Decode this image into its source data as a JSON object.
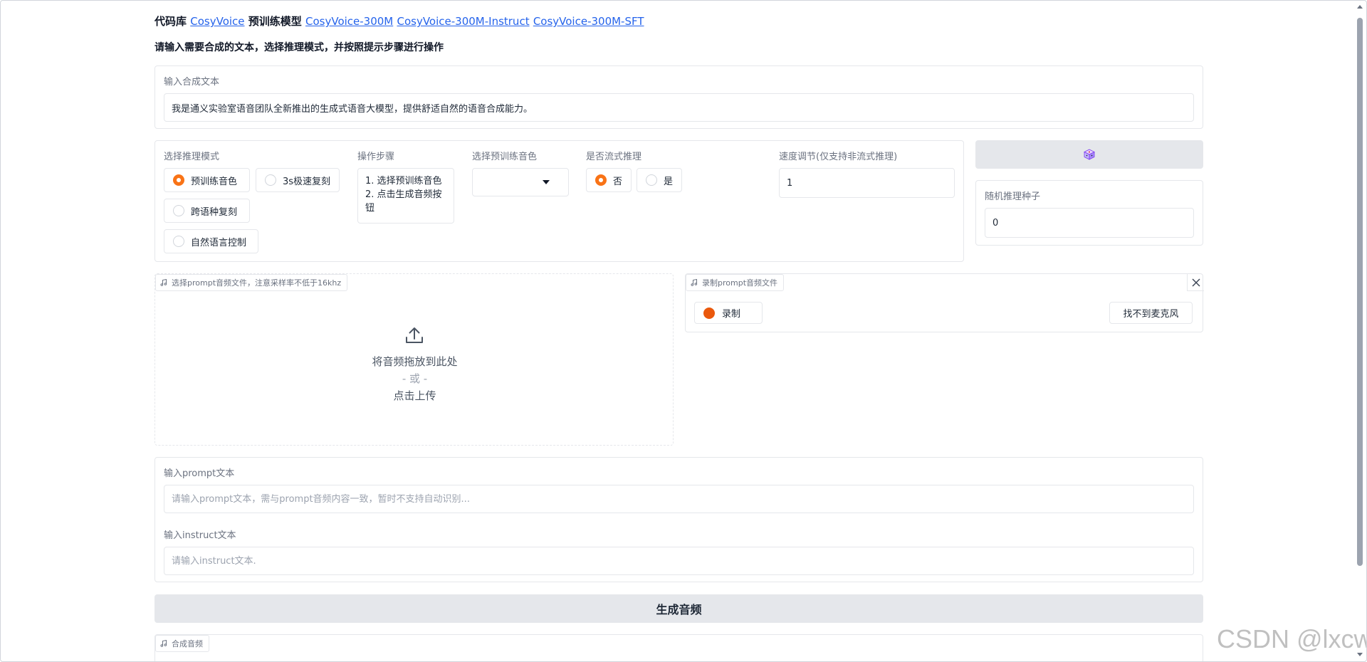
{
  "header": {
    "prefix": "代码库",
    "repo_link": "CosyVoice",
    "models_label": "预训练模型",
    "model_links": [
      "CosyVoice-300M",
      "CosyVoice-300M-Instruct",
      "CosyVoice-300M-SFT"
    ],
    "instruction": "请输入需要合成的文本，选择推理模式，并按照提示步骤进行操作"
  },
  "synth_text": {
    "label": "输入合成文本",
    "value": "我是通义实验室语音团队全新推出的生成式语音大模型，提供舒适自然的语音合成能力。"
  },
  "mode": {
    "label": "选择推理模式",
    "options": [
      "预训练音色",
      "3s极速复刻",
      "跨语种复刻",
      "自然语言控制"
    ],
    "selected_index": 0
  },
  "steps": {
    "label": "操作步骤",
    "lines": [
      "1. 选择预训练音色",
      "2. 点击生成音频按",
      "钮"
    ]
  },
  "voice": {
    "label": "选择预训练音色",
    "value": ""
  },
  "stream": {
    "label": "是否流式推理",
    "options": [
      "否",
      "是"
    ],
    "selected_index": 0
  },
  "speed": {
    "label": "速度调节(仅支持非流式推理)",
    "value": "1"
  },
  "seed": {
    "dice_icon": "dice-icon",
    "label": "随机推理种子",
    "value": "0"
  },
  "upload": {
    "tag": "选择prompt音频文件，注意采样率不低于16khz",
    "drop": "将音频拖放到此处",
    "or": "- 或 -",
    "click": "点击上传"
  },
  "record": {
    "tag": "录制prompt音频文件",
    "record_label": "录制",
    "mic_label": "找不到麦克风"
  },
  "prompt_text": {
    "label": "输入prompt文本",
    "placeholder": "请输入prompt文本，需与prompt音频内容一致，暂时不支持自动识别..."
  },
  "instruct_text": {
    "label": "输入instruct文本",
    "placeholder": "请输入instruct文本."
  },
  "generate": {
    "label": "生成音频"
  },
  "output": {
    "tag": "合成音频"
  },
  "watermark": "CSDN @lxcw",
  "colors": {
    "accent": "#f97316",
    "link": "#2563eb",
    "record_dot": "#ea580c",
    "button_gray": "#e5e7eb"
  }
}
